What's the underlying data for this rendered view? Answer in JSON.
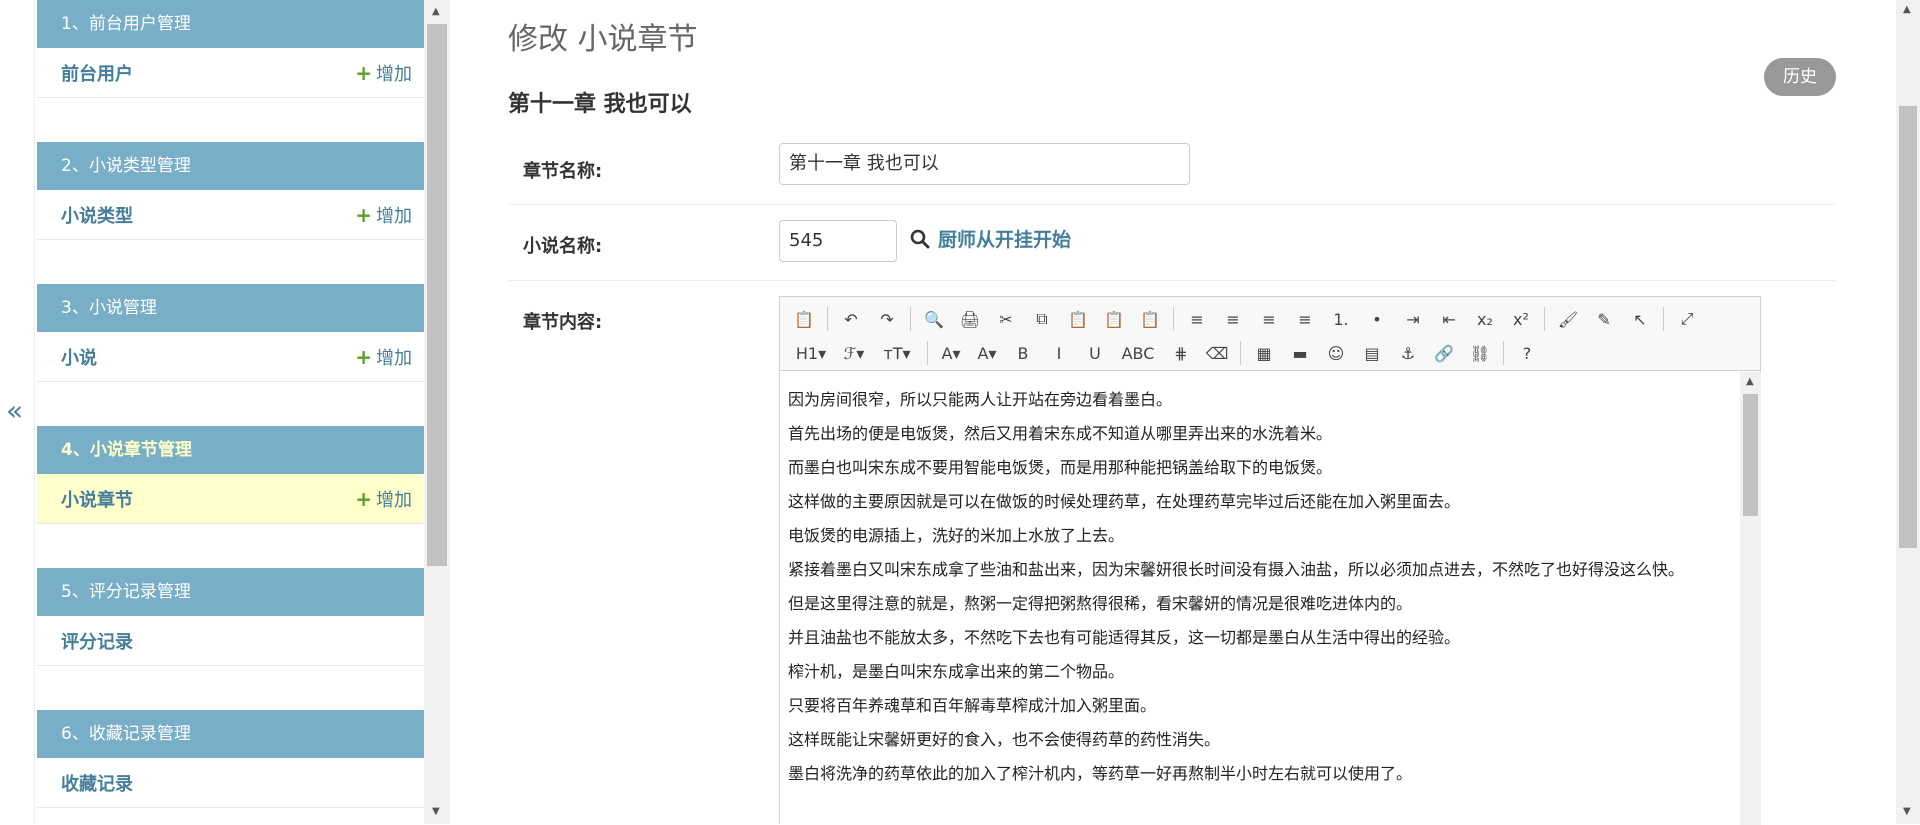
{
  "collapse_symbol": "«",
  "sidebar": {
    "modules": [
      {
        "caption": "1、前台用户管理",
        "model": "前台用户",
        "add": "增加",
        "current": false
      },
      {
        "caption": "2、小说类型管理",
        "model": "小说类型",
        "add": "增加",
        "current": false
      },
      {
        "caption": "3、小说管理",
        "model": "小说",
        "add": "增加",
        "current": false
      },
      {
        "caption": "4、小说章节管理",
        "model": "小说章节",
        "add": "增加",
        "current": true
      },
      {
        "caption": "5、评分记录管理",
        "model": "评分记录",
        "add": "",
        "current": false
      },
      {
        "caption": "6、收藏记录管理",
        "model": "收藏记录",
        "add": "",
        "current": false
      }
    ]
  },
  "main": {
    "page_title": "修改 小说章节",
    "object_title": "第十一章 我也可以",
    "history_label": "历史",
    "fields": {
      "chapter_name_label": "章节名称:",
      "chapter_name_value": "第十一章 我也可以",
      "novel_name_label": "小说名称:",
      "novel_id_value": "545",
      "novel_link": "厨师从开挂开始",
      "content_label": "章节内容:"
    },
    "editor": {
      "toolbar_row1": [
        "📋",
        "↶",
        "↷",
        "🔍",
        "🖨",
        "✂",
        "⧉",
        "📋",
        "📋",
        "📋",
        "≡",
        "≡",
        "≡",
        "≡",
        "1.",
        "•",
        "⇥",
        "⇤",
        "x₂",
        "x²",
        "🖌",
        "✎",
        "↖",
        "⤢"
      ],
      "toolbar_row2": [
        "H1▾",
        "ℱ▾",
        "тT▾",
        "A▾",
        "A▾",
        "B",
        "I",
        "U",
        "ABC",
        "⋕",
        "⌫",
        "▦",
        "▬",
        "☺",
        "▤",
        "⚓",
        "🔗",
        "⛓",
        "?"
      ],
      "paragraphs": [
        "因为房间很窄，所以只能两人让开站在旁边看着墨白。",
        "首先出场的便是电饭煲，然后又用着宋东成不知道从哪里弄出来的水洗着米。",
        "而墨白也叫宋东成不要用智能电饭煲，而是用那种能把锅盖给取下的电饭煲。",
        "这样做的主要原因就是可以在做饭的时候处理药草，在处理药草完毕过后还能在加入粥里面去。",
        "电饭煲的电源插上，洗好的米加上水放了上去。",
        "紧接着墨白又叫宋东成拿了些油和盐出来，因为宋馨妍很长时间没有摄入油盐，所以必须加点进去，不然吃了也好得没这么快。",
        "但是这里得注意的就是，熬粥一定得把粥熬得很稀，看宋馨妍的情况是很难吃进体内的。",
        "并且油盐也不能放太多，不然吃下去也有可能适得其反，这一切都是墨白从生活中得出的经验。",
        "榨汁机，是墨白叫宋东成拿出来的第二个物品。",
        "只要将百年养魂草和百年解毒草榨成汁加入粥里面。",
        "这样既能让宋馨妍更好的食入，也不会使得药草的药性消失。",
        "墨白将洗净的药草依此的加入了榨汁机内，等药草一好再熬制半小时左右就可以使用了。"
      ]
    }
  }
}
